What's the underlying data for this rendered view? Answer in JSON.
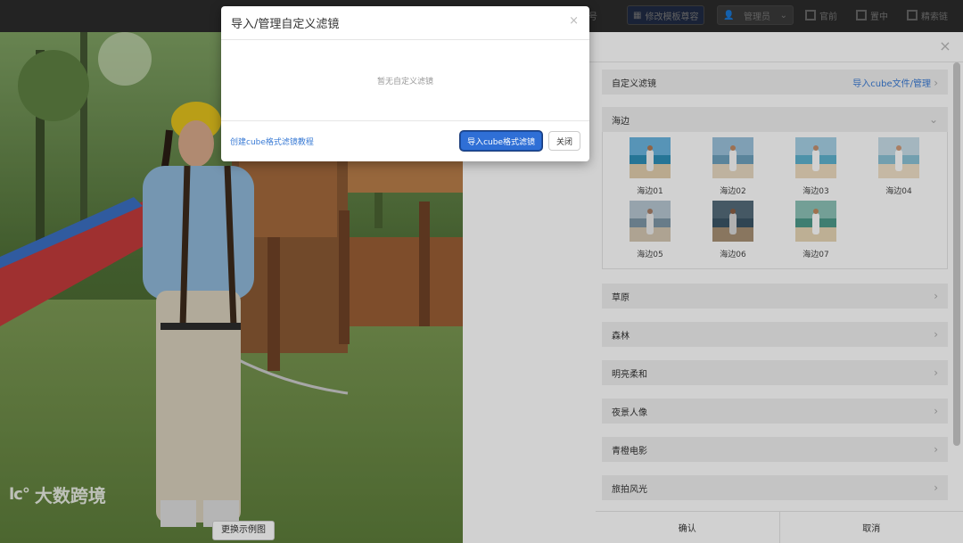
{
  "toolbar": {
    "items": [
      "众号",
      "修改模板尊容",
      "管理员",
      "官前",
      "置中",
      "精索链"
    ]
  },
  "photo": {
    "watermark_brand": "大数跨境",
    "watermark_logo": "lc°",
    "change_button": "更换示例图"
  },
  "filters": {
    "custom": {
      "label": "自定义滤镜",
      "link": "导入cube文件/管理"
    },
    "open_group": {
      "label": "海边",
      "thumbs": [
        "海边01",
        "海边02",
        "海边03",
        "海边04",
        "海边05",
        "海边06",
        "海边07"
      ]
    },
    "groups": [
      "草原",
      "森林",
      "明亮柔和",
      "夜景人像",
      "青橙电影",
      "旅拍风光"
    ]
  },
  "bottom": {
    "confirm": "确认",
    "cancel": "取消"
  },
  "modal": {
    "title": "导入/管理自定义滤镜",
    "empty_text": "暂无自定义滤镜",
    "tutorial_link": "创建cube格式滤镜教程",
    "import_button": "导入cube格式滤镜",
    "close_button": "关闭",
    "close_icon": "×"
  },
  "colors": {
    "accent": "#2f6fd6",
    "link": "#3a7bd5",
    "group_bg": "#efefef"
  }
}
